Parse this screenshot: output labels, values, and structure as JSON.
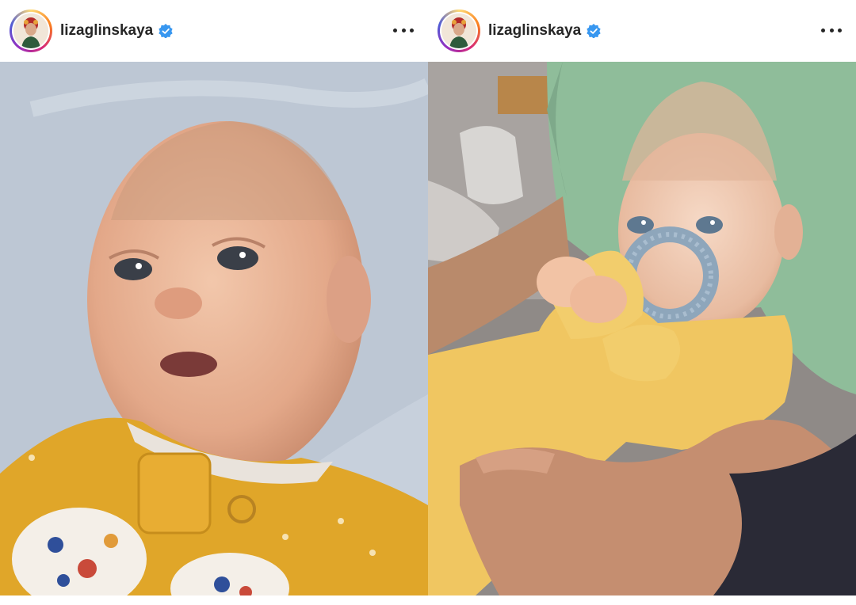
{
  "posts": [
    {
      "username": "lizaglinskaya",
      "verified": true,
      "avatar_icon": "profile-avatar",
      "more_icon": "more-options-icon",
      "photo": "baby-lying-face-up-photo"
    },
    {
      "username": "lizaglinskaya",
      "verified": true,
      "avatar_icon": "profile-avatar",
      "more_icon": "more-options-icon",
      "photo": "baby-holding-teether-ring-photo"
    }
  ],
  "colors": {
    "verified_badge": "#3897f0",
    "text": "#262626",
    "story_ring": [
      "#feda75",
      "#fa7e1e",
      "#d62976",
      "#962fbf",
      "#4f5bd5"
    ]
  }
}
